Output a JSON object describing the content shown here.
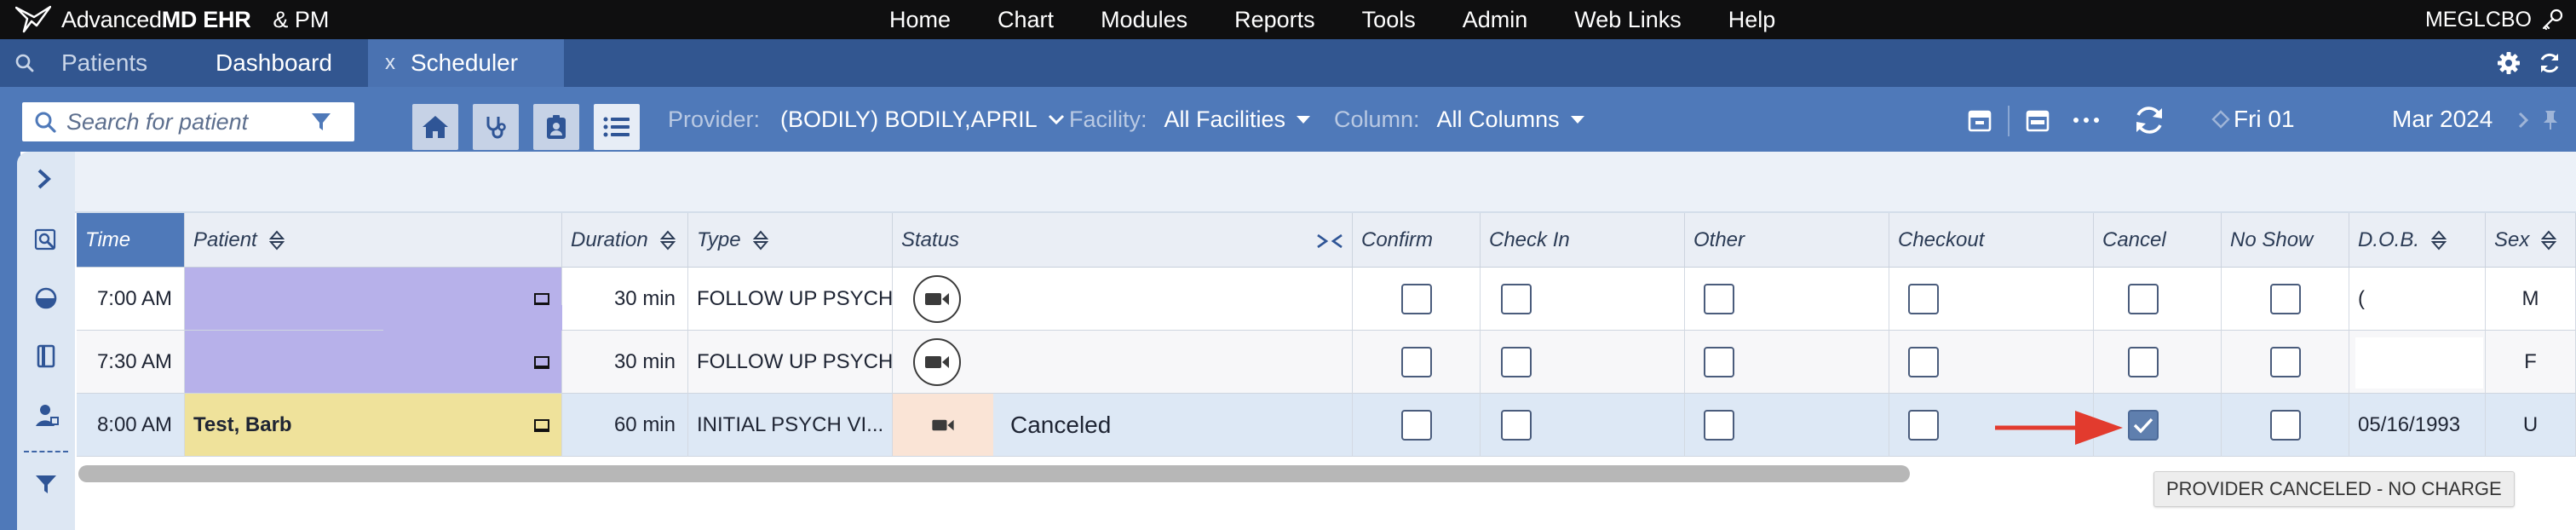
{
  "app": {
    "brand_regular": "Advanced",
    "brand_bold": "MD EHR",
    "brand_suffix": "& PM",
    "user": "MEGLCBO"
  },
  "topnav": [
    "Home",
    "Chart",
    "Modules",
    "Reports",
    "Tools",
    "Admin",
    "Web Links",
    "Help"
  ],
  "tabs": {
    "patients": "Patients",
    "dashboard": "Dashboard",
    "scheduler": "Scheduler",
    "close_glyph": "x"
  },
  "toolbar": {
    "search_placeholder": "Search for patient",
    "provider_label": "Provider:",
    "provider_value": "(BODILY) BODILY,APRIL",
    "facility_label": "Facility:",
    "facility_value": "All Facilities",
    "column_label": "Column:",
    "column_value": "All Columns",
    "date_label": "Fri 01",
    "month_label": "Mar 2024"
  },
  "grid": {
    "headers": {
      "time": "Time",
      "patient": "Patient",
      "duration": "Duration",
      "type": "Type",
      "status": "Status",
      "confirm": "Confirm",
      "checkin": "Check In",
      "other": "Other",
      "checkout": "Checkout",
      "cancel": "Cancel",
      "noshow": "No Show",
      "dob": "D.O.B.",
      "sex": "Sex"
    },
    "rows": [
      {
        "time": "7:00 AM",
        "patient": "",
        "duration": "30 min",
        "type": "FOLLOW UP PSYCH",
        "status": "",
        "cancel_checked": false,
        "dob": "(",
        "sex": "M"
      },
      {
        "time": "7:30 AM",
        "patient": "",
        "duration": "30 min",
        "type": "FOLLOW UP PSYCH",
        "status": "",
        "cancel_checked": false,
        "dob": "",
        "sex": "F"
      },
      {
        "time": "8:00 AM",
        "patient": "Test, Barb",
        "duration": "60 min",
        "type": "INITIAL PSYCH VI...",
        "status": "Canceled",
        "cancel_checked": true,
        "dob": "05/16/1993",
        "sex": "U"
      }
    ],
    "tooltip": "PROVIDER CANCELED - NO CHARGE"
  },
  "colors": {
    "topbar": "#0f0f10",
    "tabbar": "#325690",
    "toolbar": "#4f79b9",
    "selected_header": "#4f79b9",
    "patient_scheduled": "#b7b1ea",
    "patient_canceled": "#efe29b",
    "annotation_arrow": "#e23b2e"
  },
  "icons": [
    "logo-bird-icon",
    "key-icon",
    "search-icon",
    "gear-icon",
    "refresh-icon",
    "filter-icon",
    "home-icon",
    "stethoscope-icon",
    "badge-icon",
    "list-icon",
    "chevron-down-icon",
    "card-icon",
    "calendar-icon",
    "more-icon",
    "sync-icon",
    "diamond-icon",
    "chevron-right-icon",
    "pin-icon",
    "expand-icon",
    "zoom-icon",
    "half-circle-icon",
    "book-icon",
    "person-icon",
    "sort-icon",
    "collapse-icon",
    "video-icon",
    "patient-card-icon",
    "check-icon",
    "arrow-icon"
  ]
}
